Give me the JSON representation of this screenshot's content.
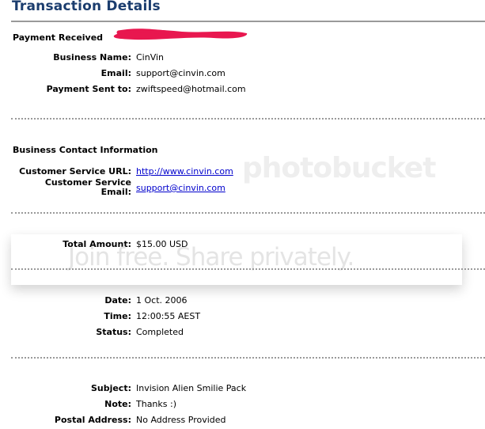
{
  "page": {
    "title": "Transaction Details"
  },
  "payment": {
    "heading": "Payment Received",
    "rows": [
      {
        "label": "Business Name:",
        "value": "CinVin"
      },
      {
        "label": "Email:",
        "value": "support@cinvin.com"
      },
      {
        "label": "Payment Sent to:",
        "value": "zwiftspeed@hotmail.com"
      }
    ]
  },
  "contact": {
    "heading": "Business Contact Information",
    "url_label": "Customer Service URL:",
    "url_value": "http://www.cinvin.com",
    "email_label_line1": "Customer Service",
    "email_label_line2": "Email:",
    "email_value": "support@cinvin.com"
  },
  "amount": {
    "label": "Total Amount:",
    "value": "$15.00 USD"
  },
  "status_block": {
    "rows": [
      {
        "label": "Date:",
        "value": "1 Oct. 2006"
      },
      {
        "label": "Time:",
        "value": "12:00:55 AEST"
      },
      {
        "label": "Status:",
        "value": "Completed"
      }
    ]
  },
  "details": {
    "rows": [
      {
        "label": "Subject:",
        "value": "Invision Alien Smilie Pack"
      },
      {
        "label": "Note:",
        "value": "Thanks :)"
      },
      {
        "label": "Postal Address:",
        "value": "No Address Provided"
      }
    ]
  },
  "watermark": {
    "brand": "photobucket",
    "tagline": "Join free. Share privately."
  },
  "colors": {
    "title": "#1b3d6e",
    "rule": "#9a9a9a",
    "link": "#0000cc",
    "redaction": "#e8174f"
  }
}
